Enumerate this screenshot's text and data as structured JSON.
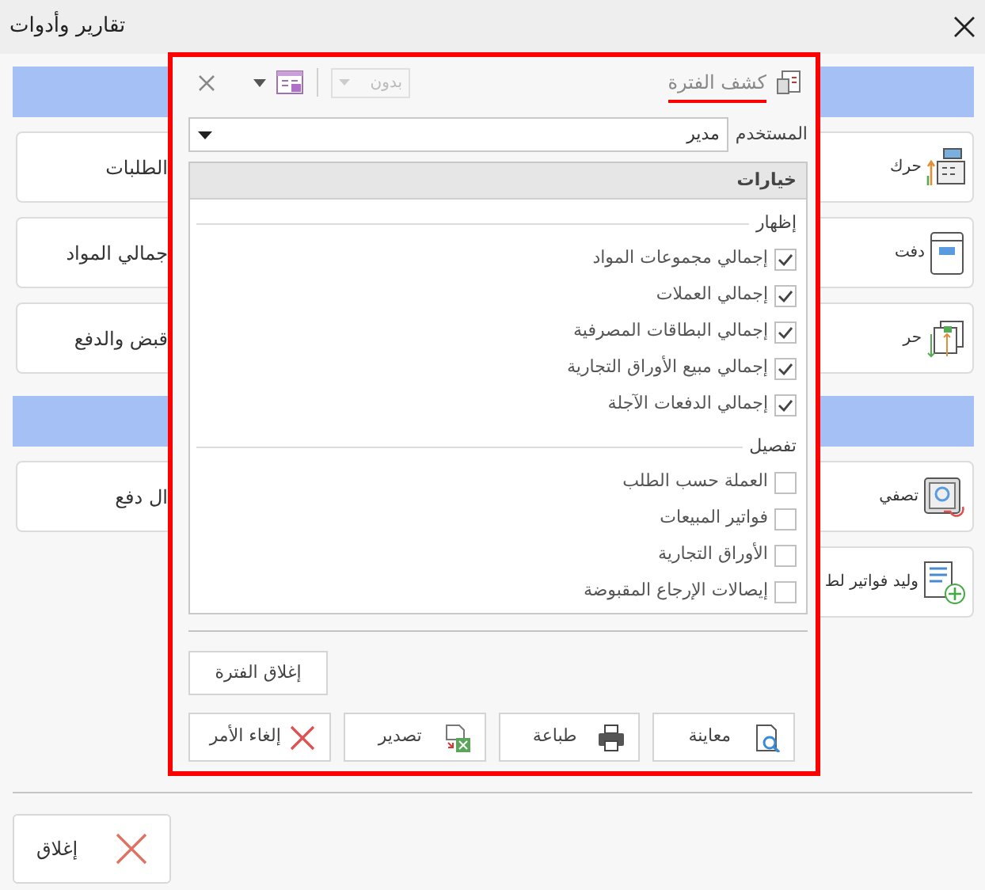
{
  "window": {
    "title": "تقارير وأدوات"
  },
  "background": {
    "sections": [
      {
        "rows": [
          {
            "left_text": "الطلبات",
            "right_text": "حرك"
          },
          {
            "left_text": "جمالي المواد",
            "right_text": "دفت"
          },
          {
            "left_text": "قبض والدفع",
            "right_text": "حر"
          }
        ]
      },
      {
        "rows": [
          {
            "left_text": "ال دفع",
            "right_text": "تصفي"
          },
          {
            "right_text": "وليد فواتير لط"
          }
        ]
      }
    ]
  },
  "dialog": {
    "title": "كشف الفترة",
    "layout_dropdown": {
      "value": "بدون",
      "disabled": true
    },
    "user": {
      "label": "المستخدم",
      "value": "مدير"
    },
    "options": {
      "header": "خيارات",
      "groups": [
        {
          "label": "إظهار",
          "items": [
            {
              "label": "إجمالي مجموعات المواد",
              "checked": true
            },
            {
              "label": "إجمالي العملات",
              "checked": true
            },
            {
              "label": "إجمالي البطاقات المصرفية",
              "checked": true
            },
            {
              "label": "إجمالي مبيع الأوراق التجارية",
              "checked": true
            },
            {
              "label": "إجمالي الدفعات الآجلة",
              "checked": true
            }
          ]
        },
        {
          "label": "تفصيل",
          "items": [
            {
              "label": "العملة حسب الطلب",
              "checked": false
            },
            {
              "label": "فواتير المبيعات",
              "checked": false
            },
            {
              "label": "الأوراق التجارية",
              "checked": false
            },
            {
              "label": "إيصالات الإرجاع المقبوضة",
              "checked": false
            }
          ]
        }
      ]
    },
    "close_period_button": "إغلاق الفترة",
    "buttons": [
      {
        "label": "معاينة"
      },
      {
        "label": "طباعة"
      },
      {
        "label": "تصدير"
      },
      {
        "label": "إلغاء الأمر"
      }
    ]
  },
  "close_button": "إغلاق"
}
